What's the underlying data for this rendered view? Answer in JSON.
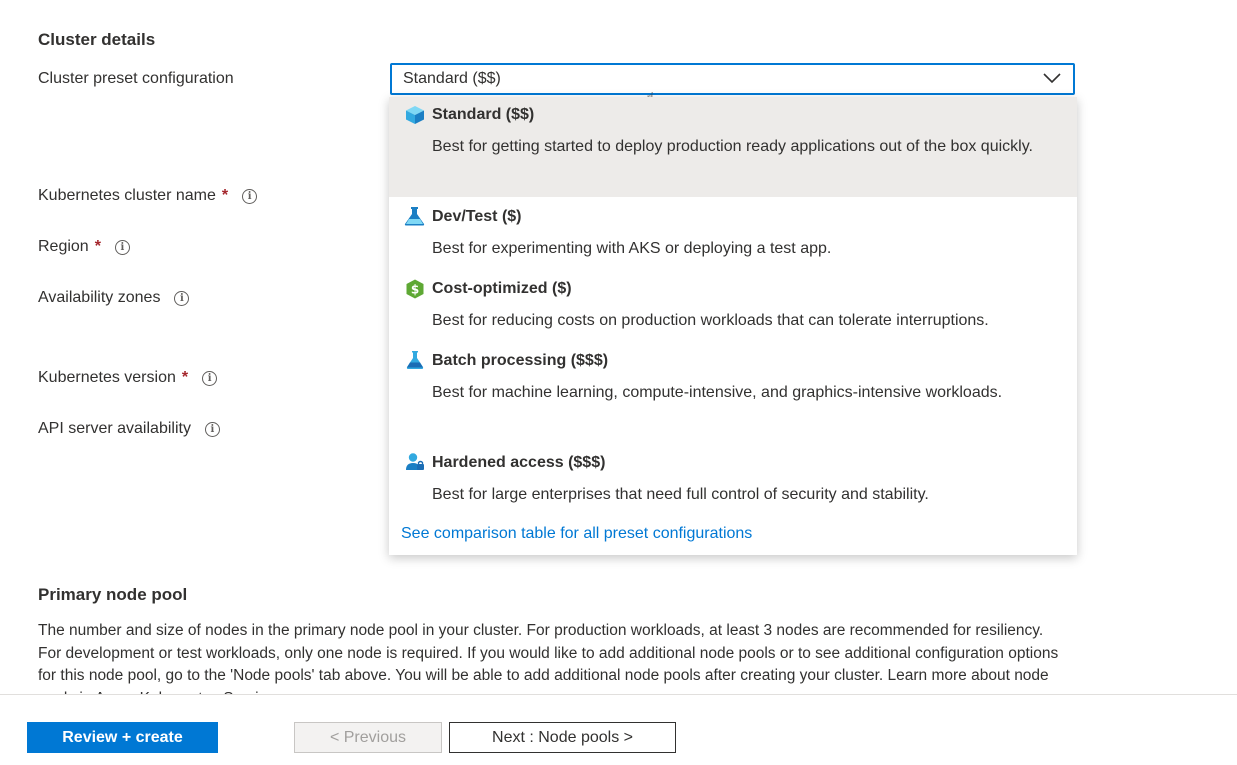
{
  "sections": {
    "cluster_details": "Cluster details",
    "primary_node_pool": "Primary node pool"
  },
  "fields": {
    "preset_label": "Cluster preset configuration",
    "cluster_name_label": "Kubernetes cluster name",
    "region_label": "Region",
    "availability_zones_label": "Availability zones",
    "kubernetes_version_label": "Kubernetes version",
    "api_server_label": "API server availability",
    "required_mark": "*",
    "info_glyph": "i"
  },
  "preset_select": {
    "value": "Standard ($$)"
  },
  "dropdown": {
    "options": [
      {
        "title": "Standard ($$)",
        "description": "Best for getting started to deploy production ready applications out of the box quickly.",
        "icon": "cube-icon",
        "selected": true
      },
      {
        "title": "Dev/Test ($)",
        "description": "Best for experimenting with AKS or deploying a test app.",
        "icon": "flask-icon",
        "selected": false
      },
      {
        "title": "Cost-optimized ($)",
        "description": "Best for reducing costs on production workloads that can tolerate interruptions.",
        "icon": "dollar-badge-icon",
        "selected": false
      },
      {
        "title": "Batch processing ($$$)",
        "description": "Best for machine learning, compute-intensive, and graphics-intensive workloads.",
        "icon": "beaker-icon",
        "selected": false
      },
      {
        "title": "Hardened access ($$$)",
        "description": "Best for large enterprises that need full control of security and stability.",
        "icon": "user-lock-icon",
        "selected": false
      }
    ],
    "comparison_link": "See comparison table for all preset configurations"
  },
  "node_pool": {
    "description": "The number and size of nodes in the primary node pool in your cluster. For production workloads, at least 3 nodes are recommended for resiliency. For development or test workloads, only one node is required. If you would like to add additional node pools or to see additional configuration options for this node pool, go to the 'Node pools' tab above. You will be able to add additional node pools after creating your cluster. Learn more about node pools in Azure Kubernetes Service"
  },
  "footer": {
    "review_create": "Review + create",
    "previous": "< Previous",
    "next": "Next : Node pools >"
  },
  "colors": {
    "accent": "#0078d4",
    "required": "#a4262c",
    "selected_option_bg": "#edebe9"
  }
}
